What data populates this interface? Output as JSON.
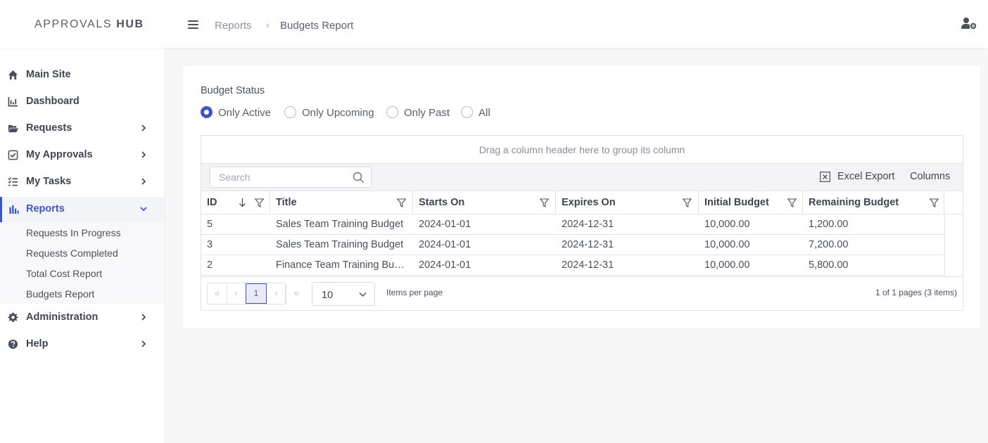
{
  "app": {
    "brand_light": "APPROVALS ",
    "brand_bold": "HUB"
  },
  "breadcrumb": {
    "parent": "Reports",
    "separator": "›",
    "current": "Budgets Report"
  },
  "sidebar": {
    "items": [
      {
        "label": "Main Site",
        "icon": "home-icon"
      },
      {
        "label": "Dashboard",
        "icon": "chart-line-icon"
      },
      {
        "label": "Requests",
        "icon": "folder-open-icon"
      },
      {
        "label": "My Approvals",
        "icon": "check-square-icon"
      },
      {
        "label": "My Tasks",
        "icon": "tasks-icon"
      },
      {
        "label": "Reports",
        "icon": "bar-chart-icon"
      },
      {
        "label": "Administration",
        "icon": "gear-icon"
      },
      {
        "label": "Help",
        "icon": "help-circle-icon"
      }
    ],
    "report_subitems": [
      "Requests In Progress",
      "Requests Completed",
      "Total Cost Report",
      "Budgets Report"
    ]
  },
  "filter": {
    "label": "Budget Status",
    "options": [
      "Only Active",
      "Only Upcoming",
      "Only Past",
      "All"
    ],
    "selected": "Only Active"
  },
  "grid": {
    "group_hint": "Drag a column header here to group its column",
    "search_placeholder": "Search",
    "excel_export_label": "Excel Export",
    "columns_label": "Columns",
    "headers": [
      "ID",
      "Title",
      "Starts On",
      "Expires On",
      "Initial Budget",
      "Remaining Budget"
    ],
    "rows": [
      [
        "5",
        "Sales Team Training Budget",
        "2024-01-01",
        "2024-12-31",
        "10,000.00",
        "1,200.00"
      ],
      [
        "3",
        "Sales Team Training Budget",
        "2024-01-01",
        "2024-12-31",
        "10,000.00",
        "7,200.00"
      ],
      [
        "2",
        "Finance Team Training Bud...",
        "2024-01-01",
        "2024-12-31",
        "10,000.00",
        "5,800.00"
      ]
    ]
  },
  "pager": {
    "first": "«",
    "prev": "‹",
    "current_page": "1",
    "next": "›",
    "last": "»",
    "page_size": "10",
    "items_per_page_label": "Items per page",
    "info": "1 of 1 pages (3 items)"
  },
  "colors": {
    "accent": "#3d55c9",
    "text": "#3f4454",
    "border": "#e1e2e7"
  }
}
